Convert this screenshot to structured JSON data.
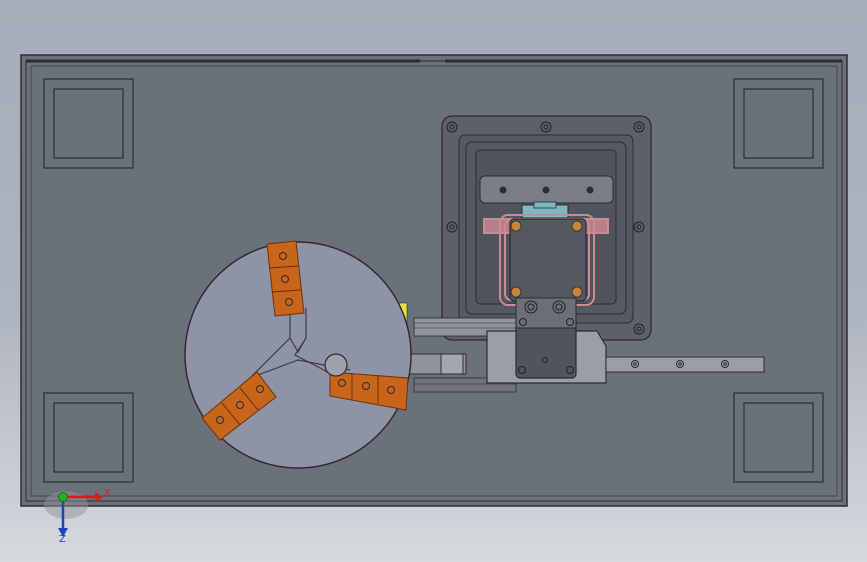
{
  "viewport": {
    "background_top": "#a7adb8",
    "background_bottom": "#d6d9de"
  },
  "colors": {
    "base_plate": "#6b717b",
    "edges": "#2a2d33",
    "chuck_body": "#8f93a6",
    "jaws": "#c8651a",
    "jaw_shadow": "#7a3c0b",
    "fixture_frame": "#5c6068",
    "red_rail": "#c98c94",
    "blue_block": "#7fb8c2",
    "yellow_edge": "#e6e33a"
  },
  "triad": {
    "x_label": "X",
    "z_label": "Z",
    "x_color": "#d02020",
    "y_color": "#20b020",
    "z_color": "#2040c0"
  },
  "parts": {
    "base_plate": "base-plate",
    "chuck": "three-jaw-chuck",
    "fixture": "gripper-fixture",
    "arm": "transfer-arm",
    "rail": "linear-rail"
  }
}
